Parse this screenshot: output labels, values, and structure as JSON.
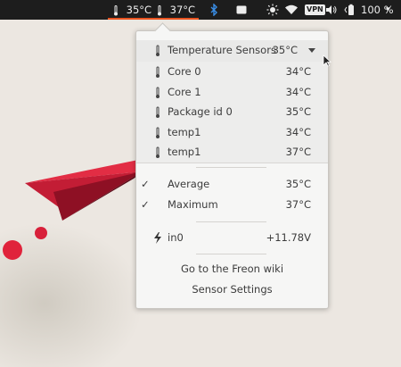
{
  "topbar": {
    "freon_temp_1": "35°C",
    "freon_temp_2": "37°C",
    "battery_percent": "100 %",
    "icons": [
      "thermometer-icon",
      "bluetooth-icon",
      "keyboard-icon",
      "brightness-icon",
      "wifi-icon",
      "vpn-icon",
      "volume-icon",
      "battery-icon"
    ],
    "vpn_label": "VPN"
  },
  "menu": {
    "header": {
      "label": "Temperature Sensors",
      "value": "35°C"
    },
    "sensors": [
      {
        "label": "Core 0",
        "value": "34°C"
      },
      {
        "label": "Core 1",
        "value": "34°C"
      },
      {
        "label": "Package id 0",
        "value": "35°C"
      },
      {
        "label": "temp1",
        "value": "34°C"
      },
      {
        "label": "temp1",
        "value": "37°C"
      }
    ],
    "summary": [
      {
        "label": "Average",
        "value": "35°C",
        "checked": true,
        "check": "✓"
      },
      {
        "label": "Maximum",
        "value": "37°C",
        "checked": true,
        "check": "✓"
      }
    ],
    "voltage": {
      "label": "in0",
      "value": "+11.78V"
    },
    "links": {
      "wiki": "Go to the Freon wiki",
      "settings": "Sensor Settings"
    }
  },
  "colors": {
    "topbar_bg": "#1d1d1d",
    "accent": "#e95420",
    "menu_bg": "#f6f6f5",
    "desktop_bg": "#ece7e1"
  }
}
